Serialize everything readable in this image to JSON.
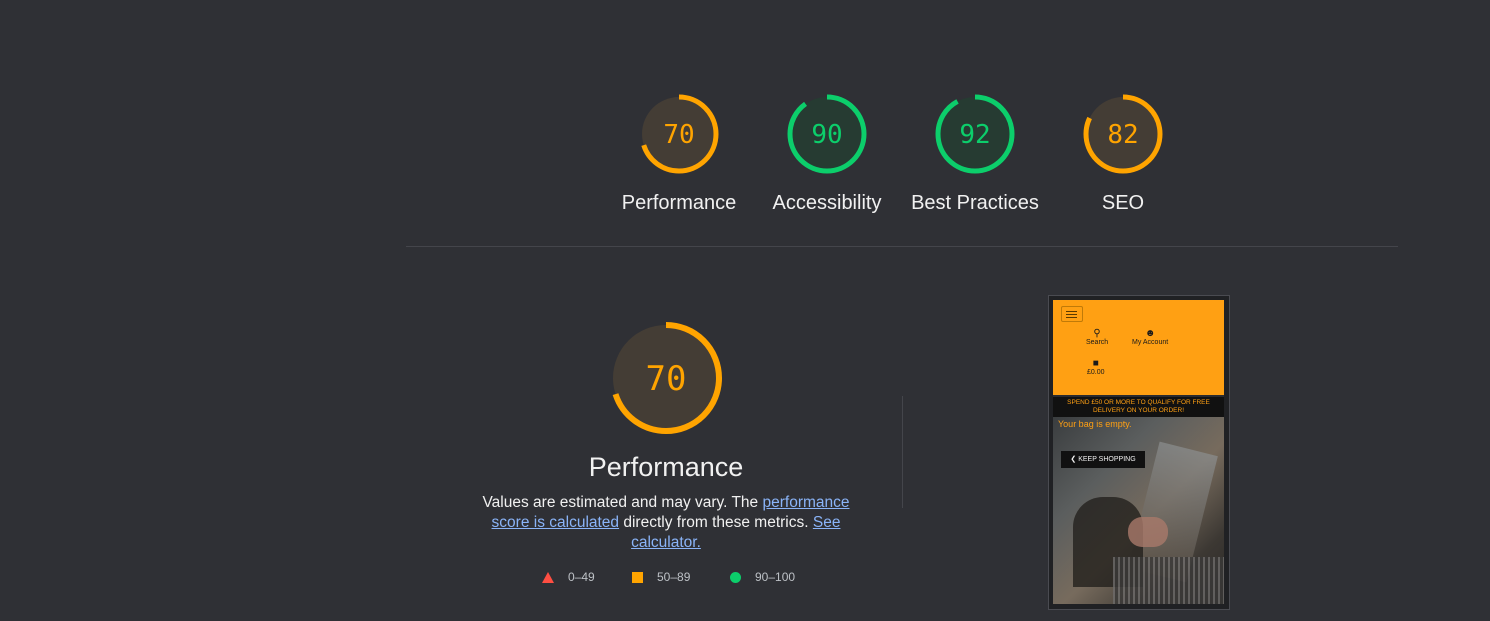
{
  "colors": {
    "background": "#2f3035",
    "fail": "#ff4e42",
    "average": "#ffa400",
    "pass": "#0cce6b",
    "link": "#8ab4f8"
  },
  "gauges": [
    {
      "label": "Performance",
      "score": 70,
      "status": "average"
    },
    {
      "label": "Accessibility",
      "score": 90,
      "status": "pass"
    },
    {
      "label": "Best Practices",
      "score": 92,
      "status": "pass"
    },
    {
      "label": "SEO",
      "score": 82,
      "status": "average"
    }
  ],
  "performance": {
    "score": 70,
    "status": "average",
    "title": "Performance",
    "desc_prefix": "Values are estimated and may vary. The ",
    "link1": "performance score is calculated",
    "desc_mid": " directly from these metrics. ",
    "link2": "See calculator."
  },
  "legend": [
    {
      "icon": "triangle-icon",
      "range": "0–49"
    },
    {
      "icon": "square-icon",
      "range": "50–89"
    },
    {
      "icon": "circle-icon",
      "range": "90–100"
    }
  ],
  "screenshot": {
    "nav_search": "Search",
    "nav_account": "My Account",
    "nav_bag": "£0.00",
    "banner": "SPEND £50 OR MORE TO QUALIFY FOR FREE DELIVERY ON YOUR ORDER!",
    "empty_text": "Your bag is empty.",
    "button": "KEEP SHOPPING"
  }
}
